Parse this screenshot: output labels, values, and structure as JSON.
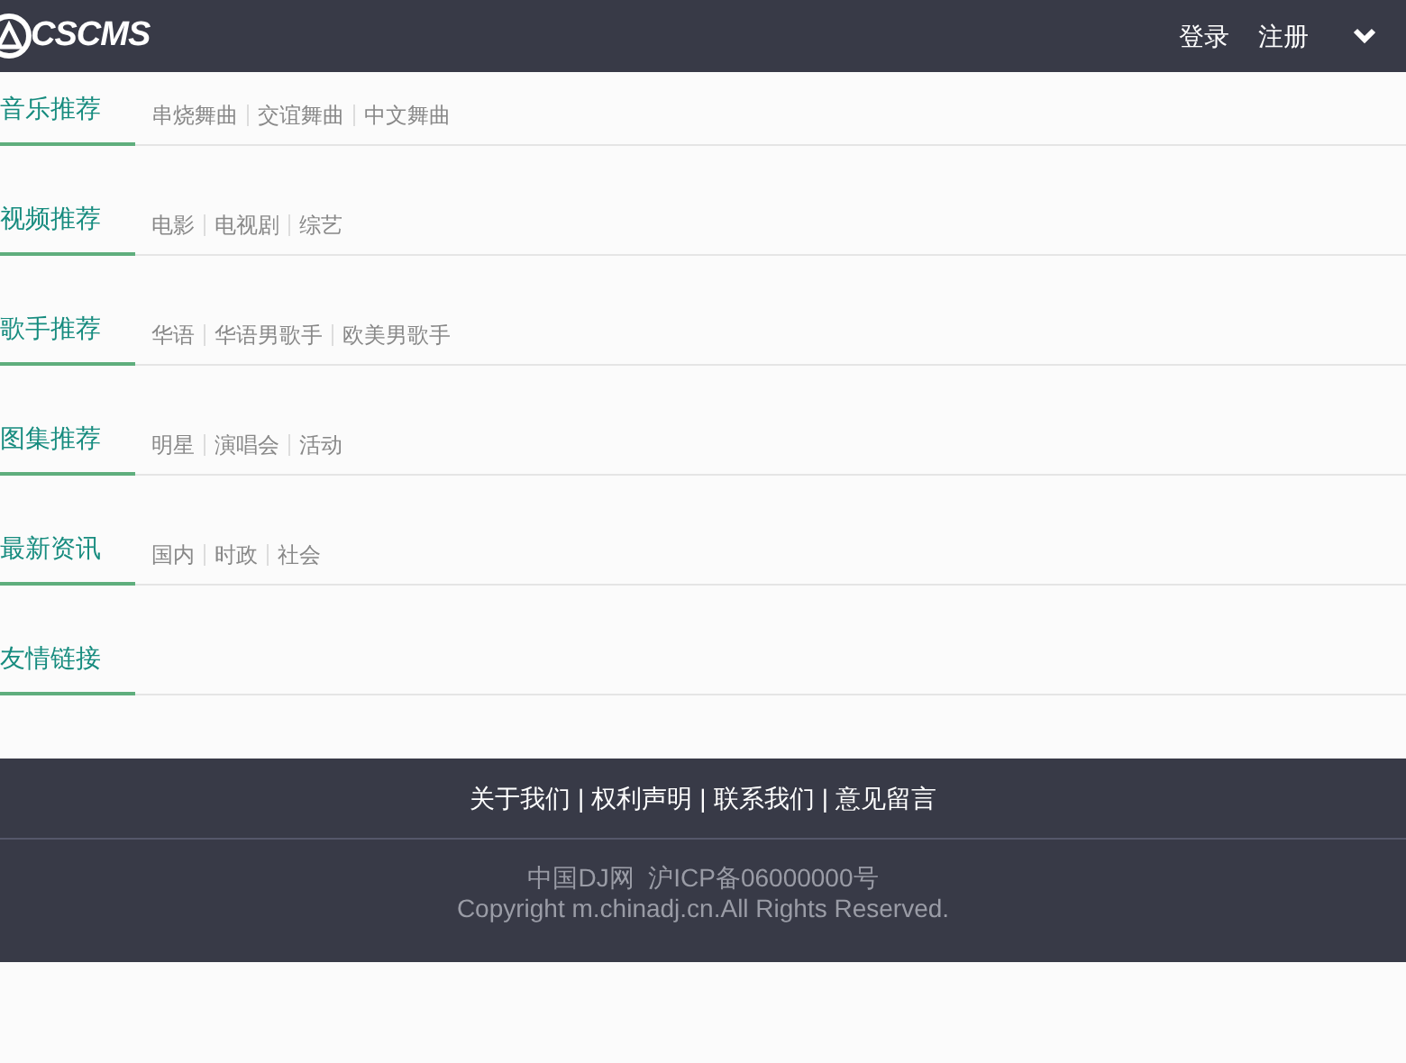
{
  "header": {
    "logo": "CSCMS",
    "links": [
      "登录",
      "注册"
    ]
  },
  "sections": [
    {
      "title": "音乐推荐",
      "links": [
        "串烧舞曲",
        "交谊舞曲",
        "中文舞曲"
      ]
    },
    {
      "title": "视频推荐",
      "links": [
        "电影",
        "电视剧",
        "综艺"
      ]
    },
    {
      "title": "歌手推荐",
      "links": [
        "华语",
        "华语男歌手",
        "欧美男歌手"
      ]
    },
    {
      "title": "图集推荐",
      "links": [
        "明星",
        "演唱会",
        "活动"
      ]
    },
    {
      "title": "最新资讯",
      "links": [
        "国内",
        "时政",
        "社会"
      ]
    },
    {
      "title": "友情链接"
    }
  ],
  "footer": {
    "separator": "|",
    "links": [
      "关于我们",
      "权利声明",
      "联系我们",
      "意见留言"
    ],
    "icp": "中国DJ网  沪ICP备06000000号",
    "copyright": "Copyright m.chinadj.cn.All Rights Reserved."
  }
}
